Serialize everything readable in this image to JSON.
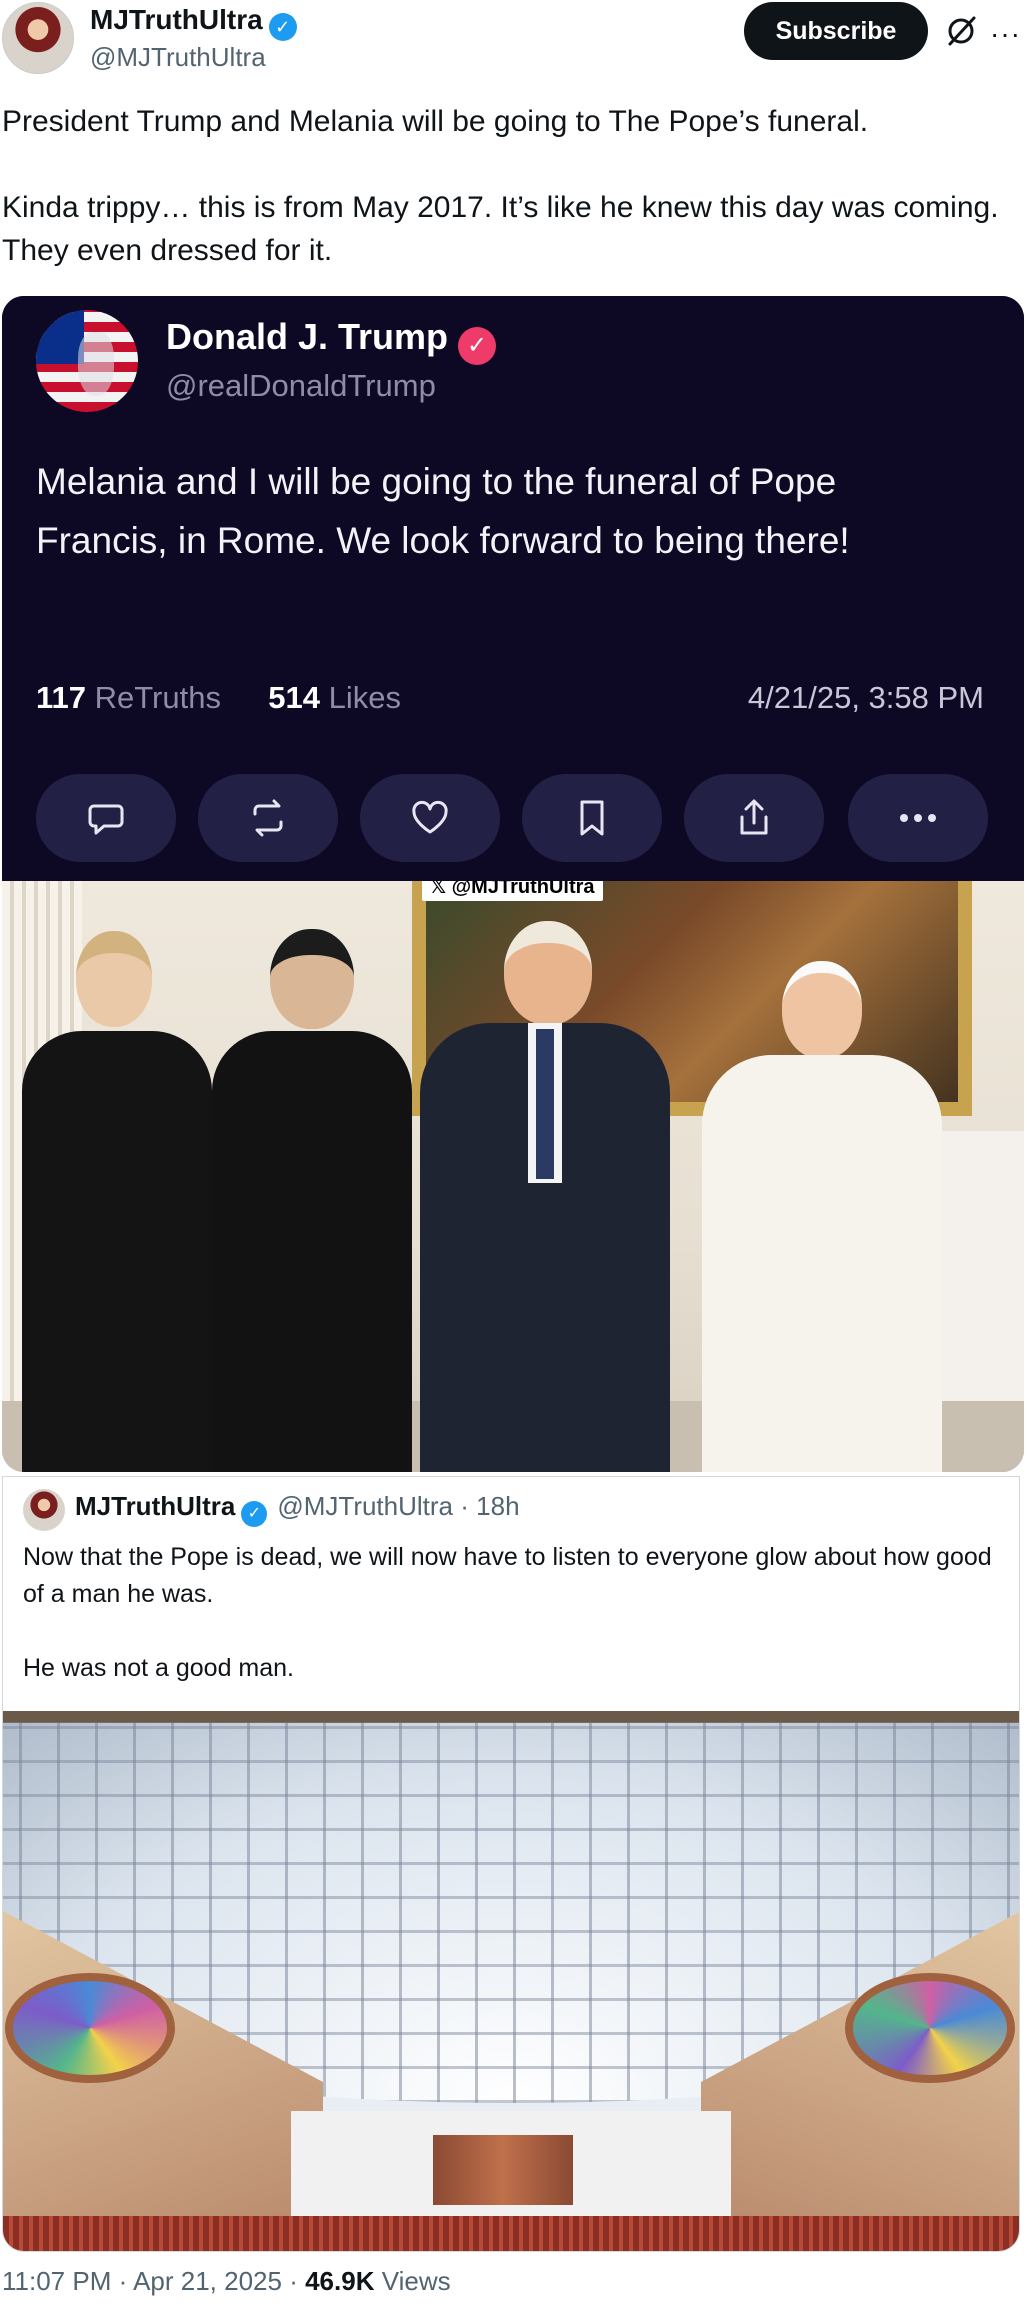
{
  "post": {
    "author_name": "MJTruthUltra",
    "author_handle": "@MJTruthUltra",
    "subscribe_label": "Subscribe",
    "text": "President Trump and Melania will be going to The Pope’s funeral.\n\nKinda trippy… this is from May 2017. It’s like he knew this day was coming. They even dressed for it.",
    "time": "11:07 PM",
    "date": "Apr 21, 2025",
    "views_count": "46.9K",
    "views_label": "Views",
    "separator": "·"
  },
  "truth_card": {
    "name": "Donald J. Trump",
    "handle": "@realDonaldTrump",
    "body": "Melania and I will be going to the funeral of Pope Francis, in Rome. We look forward to being there!",
    "retruths_count": "117",
    "retruths_label": "ReTruths",
    "likes_count": "514",
    "likes_label": "Likes",
    "timestamp": "4/21/25, 3:58 PM",
    "actions": [
      "reply-icon",
      "retruth-icon",
      "heart-icon",
      "bookmark-icon",
      "share-icon",
      "ellipsis-icon"
    ]
  },
  "photo": {
    "watermark": "@MJTruthUltra"
  },
  "quoted": {
    "author_name": "MJTruthUltra",
    "author_handle": "@MJTruthUltra",
    "age": "18h",
    "text": "Now that the Pope is dead, we will now have to listen to everyone glow about how good of a man he was.\n\nHe was not a good man."
  },
  "colors": {
    "accent_blue": "#1d9bf0",
    "truth_bg": "#0d0924",
    "truth_badge": "#ef3b6a",
    "text_primary": "#0f1419",
    "text_secondary": "#536471"
  }
}
